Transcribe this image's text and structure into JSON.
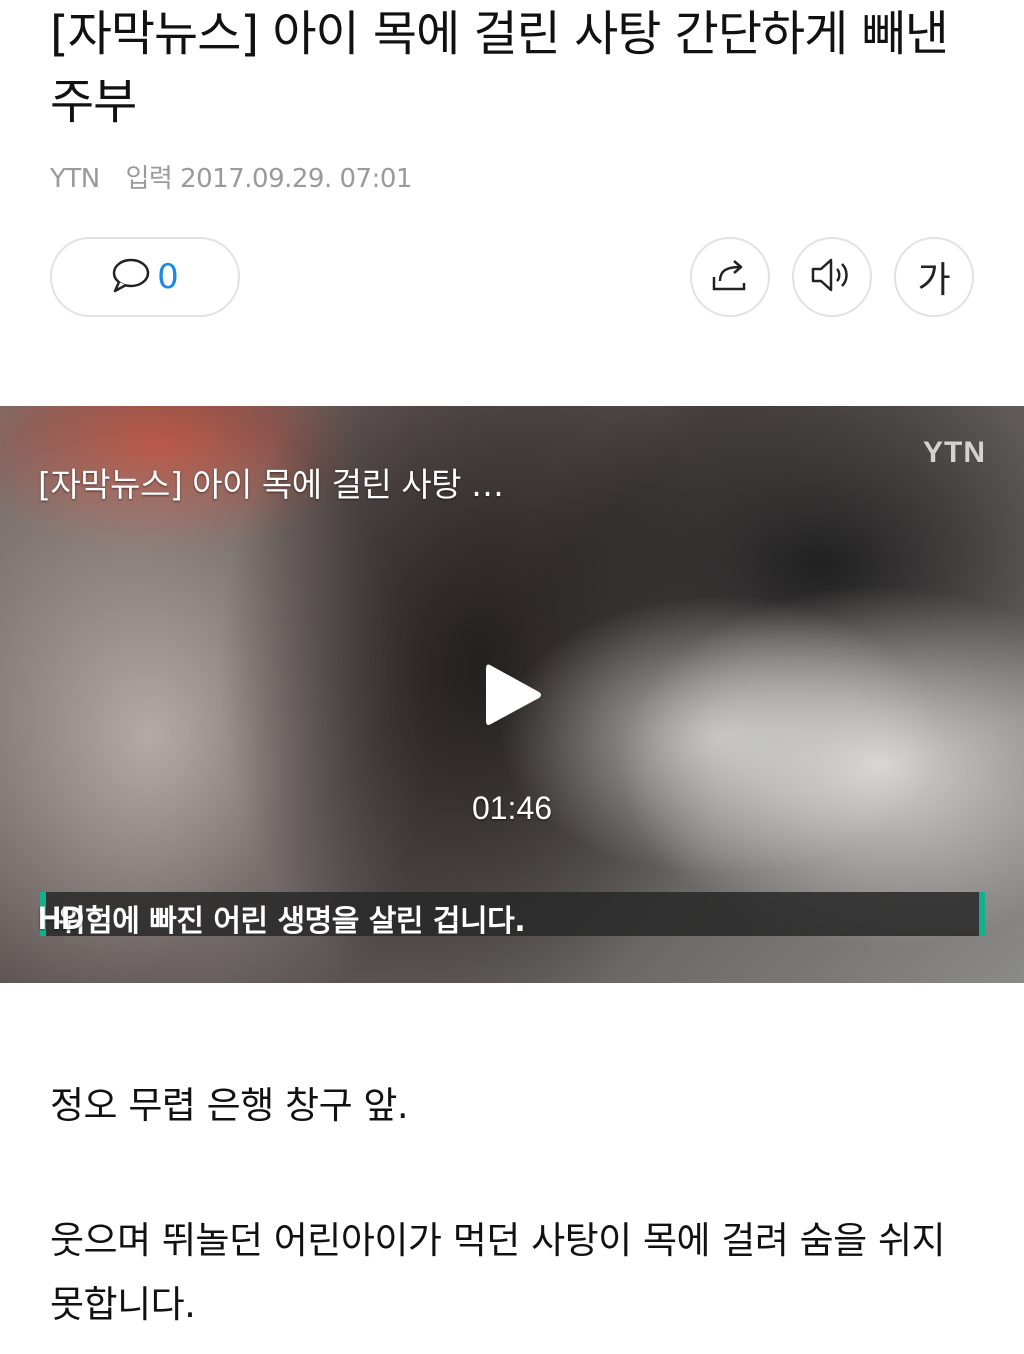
{
  "article": {
    "headline": "[자막뉴스] 아이 목에 걸린 사탕 간단하게 빼낸 주부",
    "press": "YTN",
    "date_label": "입력",
    "date": "2017.09.29. 07:01"
  },
  "toolbar": {
    "comment_count": "0",
    "font_button_label": "가"
  },
  "video": {
    "title": "[자막뉴스] 아이 목에 걸린 사탕 …",
    "channel_logo": "YTN",
    "duration": "01:46",
    "subtitle": "위험에 빠진 어린 생명을 살린 겁니다.",
    "quality_badge": "HD"
  },
  "body": {
    "paragraphs": [
      "정오 무렵 은행 창구 앞.",
      "웃으며 뛰놀던 어린아이가 먹던 사탕이 목에 걸려 숨을 쉬지 못합니다."
    ]
  },
  "icons": {
    "comment": "comment-icon",
    "share": "share-icon",
    "tts": "speaker-icon",
    "play": "play-icon"
  },
  "colors": {
    "comment_count": "#1e88e5",
    "subtitle_accent": "#14b08c",
    "meta_text": "#9a9a9a"
  }
}
